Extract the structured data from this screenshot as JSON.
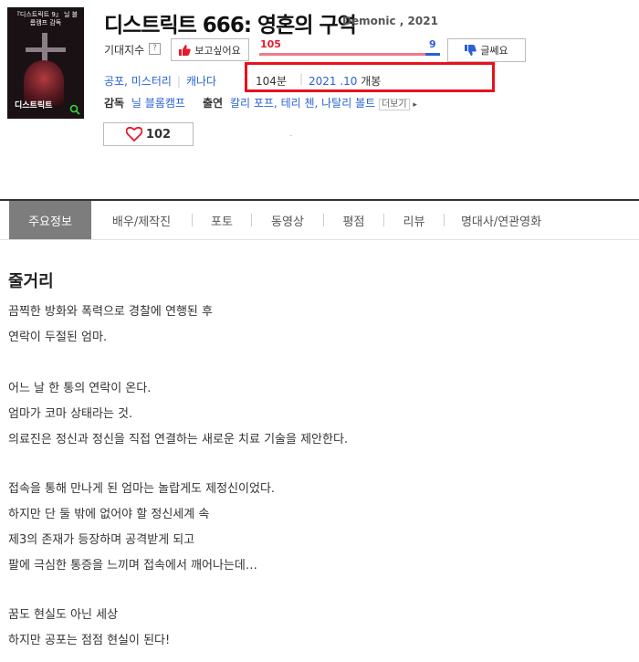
{
  "movie": {
    "title": "디스트릭트 666: 영혼의 구역",
    "original_title": "Demonic , 2021",
    "poster": {
      "band_text": "『디스트릭트 9』 닐 블롬캠프 감독",
      "title_text": "디스트릭트"
    }
  },
  "expectation": {
    "label": "기대지수",
    "help": "?",
    "want_label": "보고싶어요",
    "dislike_label": "글쎄요",
    "want_count": "105",
    "dislike_count": "9",
    "want_ratio": 0.92
  },
  "info": {
    "genres": [
      "공포",
      "미스터리"
    ],
    "country": "캐나다",
    "runtime": "104분",
    "release_date": "2021 .10",
    "release_suffix": " 개봉",
    "director_label": "감독",
    "director": "닐 블롬캠프",
    "cast_label": "출연",
    "cast": [
      "칼리 포프",
      "테리 첸",
      "나탈리 볼트"
    ],
    "more_label": "더보기"
  },
  "likes": {
    "count": "102"
  },
  "tabs": [
    {
      "label": "주요정보",
      "active": true
    },
    {
      "label": "배우/제작진",
      "active": false
    },
    {
      "label": "포토",
      "active": false
    },
    {
      "label": "동영상",
      "active": false
    },
    {
      "label": "평점",
      "active": false
    },
    {
      "label": "리뷰",
      "active": false
    },
    {
      "label": "명대사/연관영화",
      "active": false
    }
  ],
  "plot": {
    "heading": "줄거리",
    "lines": [
      "끔찍한 방화와 폭력으로 경찰에 연행된 후",
      " 연락이 두절된 엄마.",
      "",
      "어느 날 한 통의 연락이 온다.",
      "엄마가 코마 상태라는 것.",
      "의료진은 정신과 정신을 직접 연결하는 새로운 치료 기술을 제안한다.",
      "",
      "접속을 통해 만나게 된 엄마는 놀랍게도 제정신이었다.",
      "하지만 단 둘 밖에 없어야 할 정신세계 속",
      "제3의 존재가 등장하며 공격받게 되고",
      "팔에 극심한 통증을 느끼며 접속에서 깨어나는데…",
      "",
      "꿈도 현실도 아닌 세상",
      "하지만 공포는 점점 현실이 된다!"
    ]
  },
  "colors": {
    "accent_red": "#e8111b",
    "link_blue": "#2a62d6",
    "tab_active_bg": "#7d7d7d"
  }
}
